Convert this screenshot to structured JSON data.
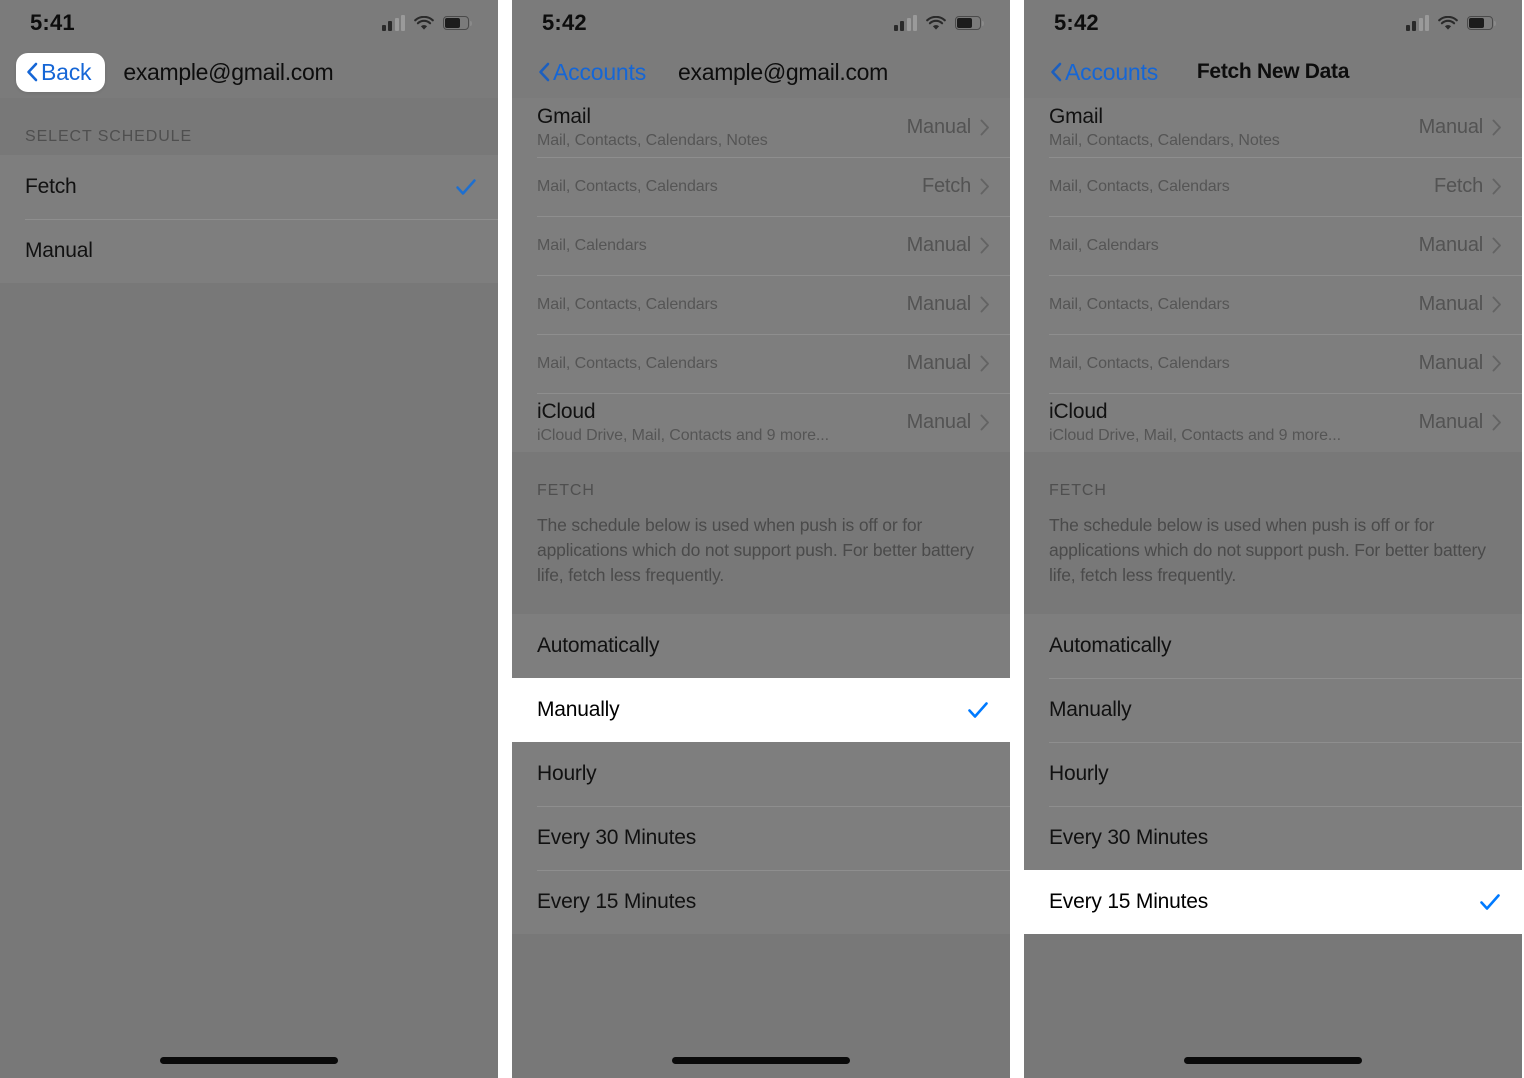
{
  "meta": {
    "accent_blue": "#1566d6",
    "check_blue": "#007aff",
    "dim_overlay": "#7b7b7b",
    "selected_row_bg": "#ffffff"
  },
  "panels": [
    {
      "id": "panel-select-schedule",
      "status": {
        "time": "5:41",
        "signal_icon": "signal-bars-icon",
        "wifi_icon": "wifi-icon",
        "battery_icon": "battery-icon"
      },
      "nav": {
        "back_label": "Back",
        "back_highlighted": true,
        "title": "example@gmail.com",
        "title_bold": false
      },
      "section_header": "SELECT SCHEDULE",
      "options": [
        {
          "label": "Fetch",
          "checked": true
        },
        {
          "label": "Manual",
          "checked": false
        }
      ]
    },
    {
      "id": "panel-fetch-new-data-manually",
      "status": {
        "time": "5:42",
        "signal_icon": "signal-bars-icon",
        "wifi_icon": "wifi-icon",
        "battery_icon": "battery-icon"
      },
      "nav": {
        "back_label": "Accounts",
        "back_highlighted": false,
        "title": "example@gmail.com",
        "title_bold": false
      },
      "accounts": [
        {
          "title": "Gmail",
          "subtitle": "Mail, Contacts, Calendars, Notes",
          "value": "Manual"
        },
        {
          "title": "",
          "subtitle": "Mail, Contacts, Calendars",
          "value": "Fetch"
        },
        {
          "title": "",
          "subtitle": "Mail, Calendars",
          "value": "Manual"
        },
        {
          "title": "",
          "subtitle": "Mail, Contacts, Calendars",
          "value": "Manual"
        },
        {
          "title": "",
          "subtitle": "Mail, Contacts, Calendars",
          "value": "Manual"
        },
        {
          "title": "iCloud",
          "subtitle": "iCloud Drive, Mail, Contacts and 9 more...",
          "value": "Manual"
        }
      ],
      "fetch_header": "FETCH",
      "fetch_description": "The schedule below is used when push is off or for applications which do not support push. For better battery life, fetch less frequently.",
      "schedule_options": [
        {
          "label": "Automatically",
          "checked": false,
          "selected": false
        },
        {
          "label": "Manually",
          "checked": true,
          "selected": true
        },
        {
          "label": "Hourly",
          "checked": false,
          "selected": false
        },
        {
          "label": "Every 30 Minutes",
          "checked": false,
          "selected": false
        },
        {
          "label": "Every 15 Minutes",
          "checked": false,
          "selected": false
        }
      ]
    },
    {
      "id": "panel-fetch-new-data-15min",
      "status": {
        "time": "5:42",
        "signal_icon": "signal-bars-icon",
        "wifi_icon": "wifi-icon",
        "battery_icon": "battery-icon"
      },
      "nav": {
        "back_label": "Accounts",
        "back_highlighted": false,
        "title": "Fetch New Data",
        "title_bold": true
      },
      "accounts": [
        {
          "title": "Gmail",
          "subtitle": "Mail, Contacts, Calendars, Notes",
          "value": "Manual"
        },
        {
          "title": "",
          "subtitle": "Mail, Contacts, Calendars",
          "value": "Fetch"
        },
        {
          "title": "",
          "subtitle": "Mail, Calendars",
          "value": "Manual"
        },
        {
          "title": "",
          "subtitle": "Mail, Contacts, Calendars",
          "value": "Manual"
        },
        {
          "title": "",
          "subtitle": "Mail, Contacts, Calendars",
          "value": "Manual"
        },
        {
          "title": "iCloud",
          "subtitle": "iCloud Drive, Mail, Contacts and 9 more...",
          "value": "Manual"
        }
      ],
      "fetch_header": "FETCH",
      "fetch_description": "The schedule below is used when push is off or for applications which do not support push. For better battery life, fetch less frequently.",
      "schedule_options": [
        {
          "label": "Automatically",
          "checked": false,
          "selected": false
        },
        {
          "label": "Manually",
          "checked": false,
          "selected": false
        },
        {
          "label": "Hourly",
          "checked": false,
          "selected": false
        },
        {
          "label": "Every 30 Minutes",
          "checked": false,
          "selected": false
        },
        {
          "label": "Every 15 Minutes",
          "checked": true,
          "selected": true
        }
      ]
    }
  ]
}
